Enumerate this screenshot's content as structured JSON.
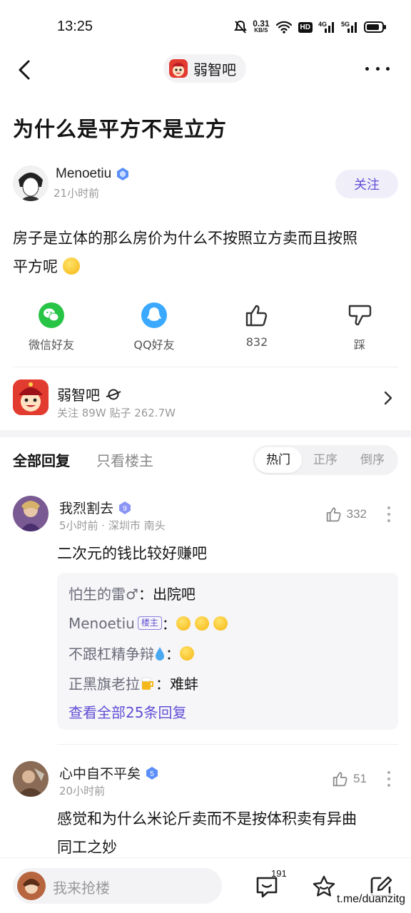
{
  "status_bar": {
    "time": "13:25",
    "net_speed_value": "0.31",
    "net_speed_unit": "KB/S",
    "hd_label": "HD",
    "signal1": "4G",
    "signal2": "5G"
  },
  "nav": {
    "forum_name": "弱智吧"
  },
  "post": {
    "title": "为什么是平方不是立方",
    "author": "Menoetiu",
    "time": "21小时前",
    "follow_label": "关注",
    "body_line1": "房子是立体的那么房价为什么不按照立方卖而且按照",
    "body_line2": "平方呢"
  },
  "share": {
    "wechat": "微信好友",
    "qq": "QQ好友",
    "like_count": "832",
    "dislike": "踩"
  },
  "forum_card": {
    "name": "弱智吧",
    "stats": "关注 89W  贴子 262.7W"
  },
  "tabs": {
    "all": "全部回复",
    "op_only": "只看楼主",
    "sort_hot": "热门",
    "sort_asc": "正序",
    "sort_desc": "倒序"
  },
  "comments": [
    {
      "name": "我烈割去",
      "level": "9",
      "meta": "5小时前 · 深圳市 南头",
      "likes": "332",
      "text": "二次元的钱比较好赚吧",
      "replies": [
        {
          "name": "怕生的雷♂",
          "text": "出院吧"
        },
        {
          "name": "Menoetiu",
          "tag": "楼主",
          "text": ""
        },
        {
          "name": "不跟杠精争辩",
          "text": ""
        },
        {
          "name": "正黑旗老拉",
          "text": "难蚌"
        }
      ],
      "view_all": "查看全部25条回复"
    },
    {
      "name": "心中自不平矣",
      "level": "5",
      "meta": "20小时前",
      "likes": "51",
      "text_line1": "感觉和为什么米论斤卖而不是按体积卖有异曲",
      "text_line2": "同工之妙"
    }
  ],
  "bottom_bar": {
    "input_placeholder": "我来抢楼",
    "comment_count": "191"
  },
  "watermark": "t.me/duanzitg",
  "colors": {
    "accent": "#614fd6",
    "forum_red": "#e23b2f",
    "wechat_green": "#28c445",
    "qq_blue": "#3aa9ff",
    "level_blue": "#5b8ff9"
  },
  "icons": [
    "back-arrow-icon",
    "more-icon",
    "wechat-icon",
    "qq-icon",
    "thumbs-up-icon",
    "thumbs-down-icon",
    "chevron-right-icon",
    "comment-icon",
    "star-icon",
    "edit-icon"
  ]
}
